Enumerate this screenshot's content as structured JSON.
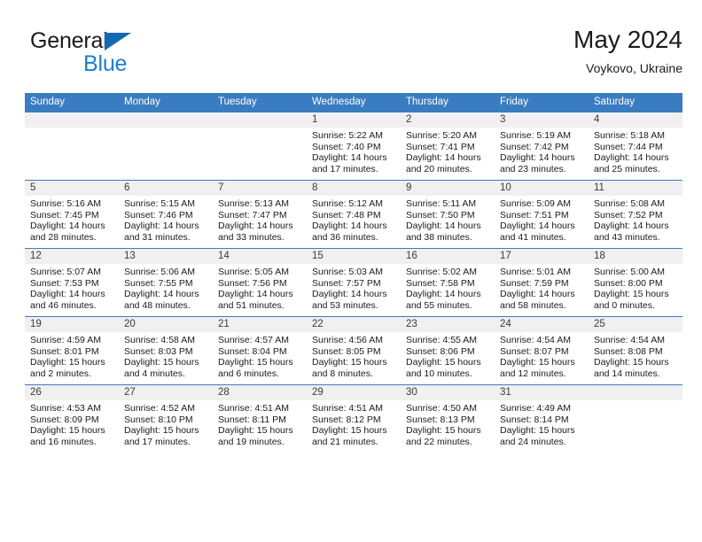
{
  "brand": {
    "line1": "General",
    "line2": "Blue",
    "triangle_color": "#1268b3",
    "blue_color": "#1a7fd4"
  },
  "header": {
    "title": "May 2024",
    "subtitle": "Voykovo, Ukraine"
  },
  "theme": {
    "header_blue": "#3a7cc0",
    "date_band_gray": "#f0f0f0",
    "text": "#1b1b1b"
  },
  "weekday_headers": [
    "Sunday",
    "Monday",
    "Tuesday",
    "Wednesday",
    "Thursday",
    "Friday",
    "Saturday"
  ],
  "labels": {
    "sunrise": "Sunrise:",
    "sunset": "Sunset:",
    "daylight": "Daylight:"
  },
  "weeks": [
    [
      {
        "day": "",
        "lines": []
      },
      {
        "day": "",
        "lines": []
      },
      {
        "day": "",
        "lines": []
      },
      {
        "day": "1",
        "lines": [
          "Sunrise: 5:22 AM",
          "Sunset: 7:40 PM",
          "Daylight: 14 hours and 17 minutes."
        ]
      },
      {
        "day": "2",
        "lines": [
          "Sunrise: 5:20 AM",
          "Sunset: 7:41 PM",
          "Daylight: 14 hours and 20 minutes."
        ]
      },
      {
        "day": "3",
        "lines": [
          "Sunrise: 5:19 AM",
          "Sunset: 7:42 PM",
          "Daylight: 14 hours and 23 minutes."
        ]
      },
      {
        "day": "4",
        "lines": [
          "Sunrise: 5:18 AM",
          "Sunset: 7:44 PM",
          "Daylight: 14 hours and 25 minutes."
        ]
      }
    ],
    [
      {
        "day": "5",
        "lines": [
          "Sunrise: 5:16 AM",
          "Sunset: 7:45 PM",
          "Daylight: 14 hours and 28 minutes."
        ]
      },
      {
        "day": "6",
        "lines": [
          "Sunrise: 5:15 AM",
          "Sunset: 7:46 PM",
          "Daylight: 14 hours and 31 minutes."
        ]
      },
      {
        "day": "7",
        "lines": [
          "Sunrise: 5:13 AM",
          "Sunset: 7:47 PM",
          "Daylight: 14 hours and 33 minutes."
        ]
      },
      {
        "day": "8",
        "lines": [
          "Sunrise: 5:12 AM",
          "Sunset: 7:48 PM",
          "Daylight: 14 hours and 36 minutes."
        ]
      },
      {
        "day": "9",
        "lines": [
          "Sunrise: 5:11 AM",
          "Sunset: 7:50 PM",
          "Daylight: 14 hours and 38 minutes."
        ]
      },
      {
        "day": "10",
        "lines": [
          "Sunrise: 5:09 AM",
          "Sunset: 7:51 PM",
          "Daylight: 14 hours and 41 minutes."
        ]
      },
      {
        "day": "11",
        "lines": [
          "Sunrise: 5:08 AM",
          "Sunset: 7:52 PM",
          "Daylight: 14 hours and 43 minutes."
        ]
      }
    ],
    [
      {
        "day": "12",
        "lines": [
          "Sunrise: 5:07 AM",
          "Sunset: 7:53 PM",
          "Daylight: 14 hours and 46 minutes."
        ]
      },
      {
        "day": "13",
        "lines": [
          "Sunrise: 5:06 AM",
          "Sunset: 7:55 PM",
          "Daylight: 14 hours and 48 minutes."
        ]
      },
      {
        "day": "14",
        "lines": [
          "Sunrise: 5:05 AM",
          "Sunset: 7:56 PM",
          "Daylight: 14 hours and 51 minutes."
        ]
      },
      {
        "day": "15",
        "lines": [
          "Sunrise: 5:03 AM",
          "Sunset: 7:57 PM",
          "Daylight: 14 hours and 53 minutes."
        ]
      },
      {
        "day": "16",
        "lines": [
          "Sunrise: 5:02 AM",
          "Sunset: 7:58 PM",
          "Daylight: 14 hours and 55 minutes."
        ]
      },
      {
        "day": "17",
        "lines": [
          "Sunrise: 5:01 AM",
          "Sunset: 7:59 PM",
          "Daylight: 14 hours and 58 minutes."
        ]
      },
      {
        "day": "18",
        "lines": [
          "Sunrise: 5:00 AM",
          "Sunset: 8:00 PM",
          "Daylight: 15 hours and 0 minutes."
        ]
      }
    ],
    [
      {
        "day": "19",
        "lines": [
          "Sunrise: 4:59 AM",
          "Sunset: 8:01 PM",
          "Daylight: 15 hours and 2 minutes."
        ]
      },
      {
        "day": "20",
        "lines": [
          "Sunrise: 4:58 AM",
          "Sunset: 8:03 PM",
          "Daylight: 15 hours and 4 minutes."
        ]
      },
      {
        "day": "21",
        "lines": [
          "Sunrise: 4:57 AM",
          "Sunset: 8:04 PM",
          "Daylight: 15 hours and 6 minutes."
        ]
      },
      {
        "day": "22",
        "lines": [
          "Sunrise: 4:56 AM",
          "Sunset: 8:05 PM",
          "Daylight: 15 hours and 8 minutes."
        ]
      },
      {
        "day": "23",
        "lines": [
          "Sunrise: 4:55 AM",
          "Sunset: 8:06 PM",
          "Daylight: 15 hours and 10 minutes."
        ]
      },
      {
        "day": "24",
        "lines": [
          "Sunrise: 4:54 AM",
          "Sunset: 8:07 PM",
          "Daylight: 15 hours and 12 minutes."
        ]
      },
      {
        "day": "25",
        "lines": [
          "Sunrise: 4:54 AM",
          "Sunset: 8:08 PM",
          "Daylight: 15 hours and 14 minutes."
        ]
      }
    ],
    [
      {
        "day": "26",
        "lines": [
          "Sunrise: 4:53 AM",
          "Sunset: 8:09 PM",
          "Daylight: 15 hours and 16 minutes."
        ]
      },
      {
        "day": "27",
        "lines": [
          "Sunrise: 4:52 AM",
          "Sunset: 8:10 PM",
          "Daylight: 15 hours and 17 minutes."
        ]
      },
      {
        "day": "28",
        "lines": [
          "Sunrise: 4:51 AM",
          "Sunset: 8:11 PM",
          "Daylight: 15 hours and 19 minutes."
        ]
      },
      {
        "day": "29",
        "lines": [
          "Sunrise: 4:51 AM",
          "Sunset: 8:12 PM",
          "Daylight: 15 hours and 21 minutes."
        ]
      },
      {
        "day": "30",
        "lines": [
          "Sunrise: 4:50 AM",
          "Sunset: 8:13 PM",
          "Daylight: 15 hours and 22 minutes."
        ]
      },
      {
        "day": "31",
        "lines": [
          "Sunrise: 4:49 AM",
          "Sunset: 8:14 PM",
          "Daylight: 15 hours and 24 minutes."
        ]
      },
      {
        "day": "",
        "lines": []
      }
    ]
  ]
}
